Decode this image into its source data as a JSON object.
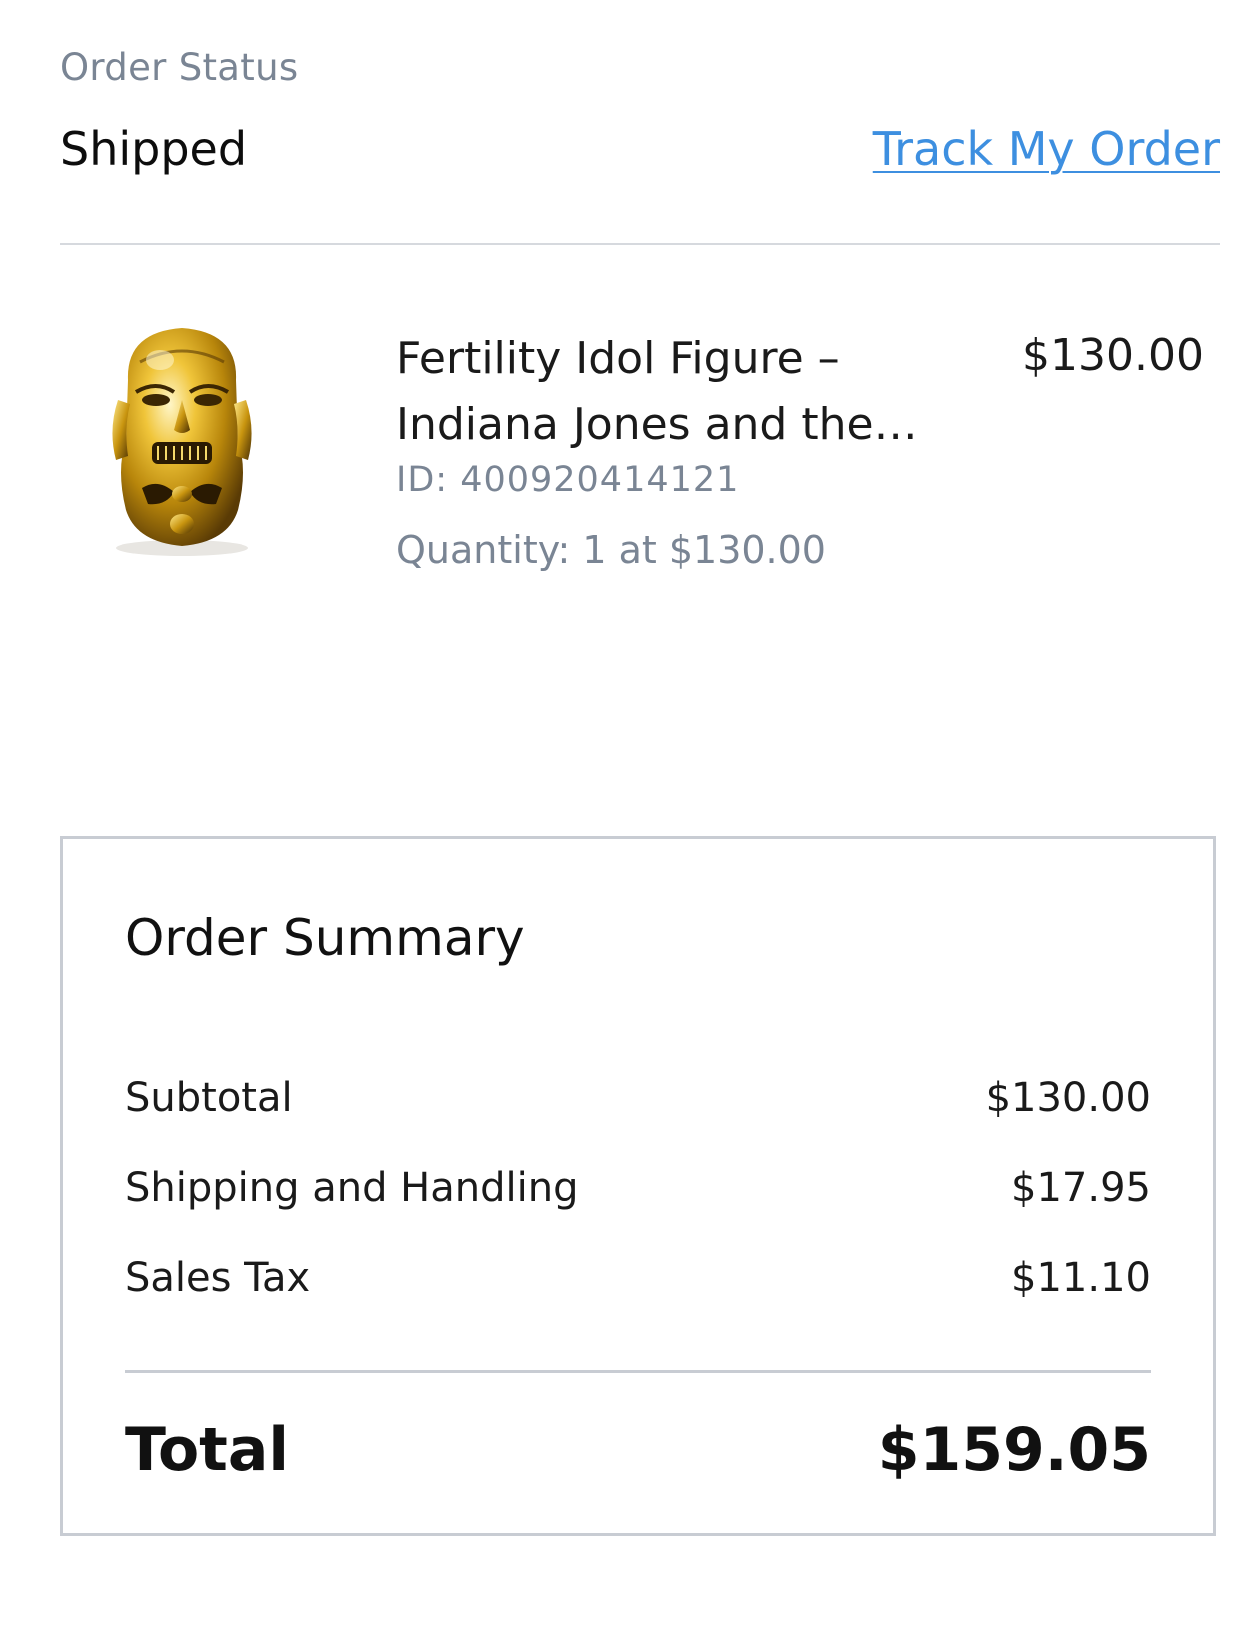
{
  "order_status": {
    "label": "Order Status",
    "value": "Shipped",
    "track_link": "Track My Order"
  },
  "item": {
    "title": "Fertility Idol Figure – Indiana Jones and the Raiders of the Lost Ark",
    "price": "$130.00",
    "id": "ID: 400920414121",
    "quantity": "Quantity: 1 at $130.00",
    "image_icon": "golden-idol-figure-image"
  },
  "summary": {
    "title": "Order Summary",
    "rows": [
      {
        "label": "Subtotal",
        "value": "$130.00"
      },
      {
        "label": "Shipping and Handling",
        "value": "$17.95"
      },
      {
        "label": "Sales Tax",
        "value": "$11.10"
      }
    ],
    "total_label": "Total",
    "total_value": "$159.05"
  },
  "colors": {
    "link": "#3d8fe0",
    "muted_text": "#7a8594",
    "border": "#c8ccd3",
    "gold": "#d9a821"
  }
}
